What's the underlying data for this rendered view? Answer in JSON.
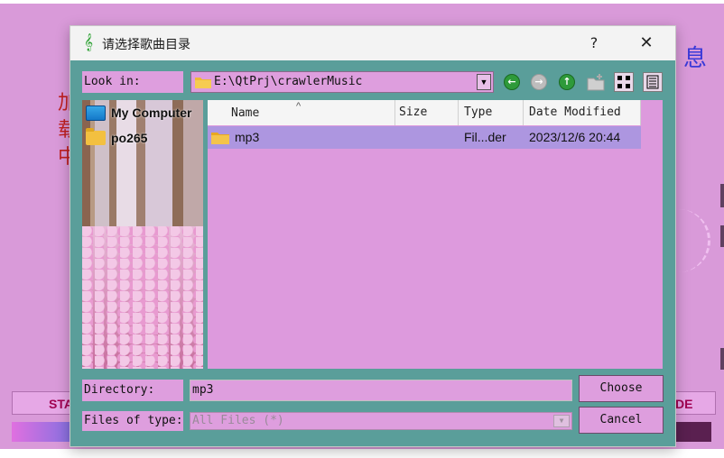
{
  "background": {
    "right_text": "息",
    "left_glyphs": "加载中",
    "left_button_label": "STA",
    "right_button_label": "DE"
  },
  "dialog": {
    "title": "请选择歌曲目录",
    "title_icon": "music-note-icon",
    "help_label": "?",
    "close_label": "✕"
  },
  "look_in": {
    "label": "Look in:",
    "path": "E:\\QtPrj\\crawlerMusic"
  },
  "toolbar": {
    "icons": [
      "back-icon",
      "forward-icon",
      "parent-dir-icon",
      "new-folder-icon",
      "list-view-icon",
      "detail-view-icon"
    ]
  },
  "sidebar": {
    "items": [
      {
        "label": "My Computer",
        "icon": "monitor-icon"
      },
      {
        "label": "po265",
        "icon": "folder-icon"
      }
    ]
  },
  "file_list": {
    "columns": [
      "Name",
      "Size",
      "Type",
      "Date Modified"
    ],
    "rows": [
      {
        "name": "mp3",
        "size": "",
        "type": "Fil...der",
        "date_modified": "2023/12/6 20:44",
        "selected": true
      }
    ]
  },
  "directory": {
    "label": "Directory:",
    "value": "mp3"
  },
  "file_type": {
    "label": "Files of type:",
    "value": "All Files (*)"
  },
  "buttons": {
    "choose": "Choose",
    "cancel": "Cancel"
  },
  "colors": {
    "dialog_body": "#5a9e9a",
    "widget_bg": "#de9ede",
    "selection": "#ad96e0",
    "app_bg": "#d99ad9"
  }
}
